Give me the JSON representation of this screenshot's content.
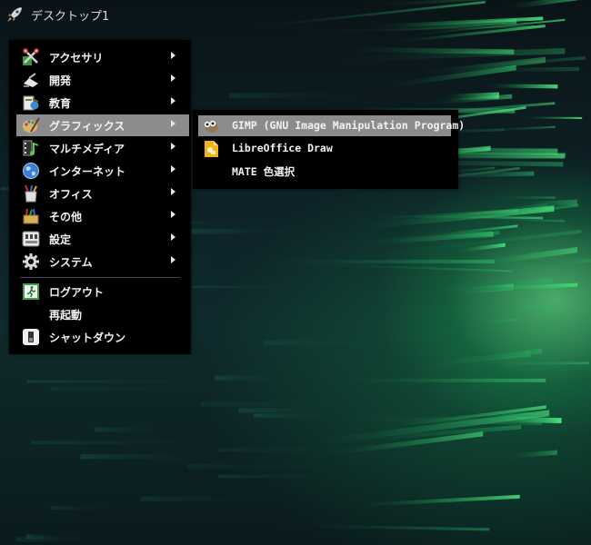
{
  "panel": {
    "title": "デスクトップ1",
    "icon": "rocket-icon"
  },
  "menu": {
    "items": [
      {
        "label": "アクセサリ",
        "icon": "accessories-icon",
        "submenu": true
      },
      {
        "label": "開発",
        "icon": "development-icon",
        "submenu": true
      },
      {
        "label": "教育",
        "icon": "education-icon",
        "submenu": true
      },
      {
        "label": "グラフィックス",
        "icon": "graphics-icon",
        "submenu": true,
        "selected": true
      },
      {
        "label": "マルチメディア",
        "icon": "multimedia-icon",
        "submenu": true
      },
      {
        "label": "インターネット",
        "icon": "internet-icon",
        "submenu": true
      },
      {
        "label": "オフィス",
        "icon": "office-icon",
        "submenu": true
      },
      {
        "label": "その他",
        "icon": "other-icon",
        "submenu": true
      },
      {
        "label": "設定",
        "icon": "settings-icon",
        "submenu": true
      },
      {
        "label": "システム",
        "icon": "system-gear-icon",
        "submenu": true
      }
    ],
    "session": [
      {
        "label": "ログアウト",
        "icon": "logout-icon"
      },
      {
        "label": "再起動",
        "icon": ""
      },
      {
        "label": "シャットダウン",
        "icon": "shutdown-icon"
      }
    ]
  },
  "submenu": {
    "items": [
      {
        "label": "GIMP (GNU Image Manipulation Program)",
        "icon": "gimp-icon",
        "selected": true
      },
      {
        "label": "LibreOffice Draw",
        "icon": "libreoffice-draw-icon"
      },
      {
        "label": "MATE 色選択",
        "icon": ""
      }
    ]
  },
  "colors": {
    "menu_bg": "#000000",
    "selection": "#8c8c8c",
    "text": "#f2f2f2",
    "wallpaper_glow": "#3cff78"
  }
}
